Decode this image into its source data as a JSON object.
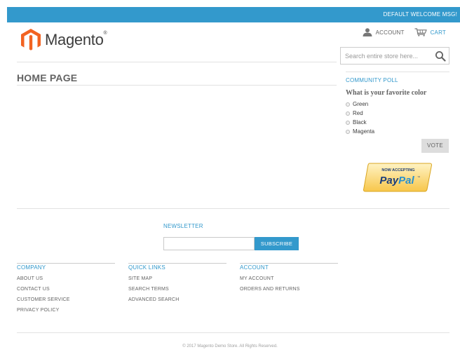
{
  "topbar": {
    "welcome": "DEFAULT WELCOME MSG!"
  },
  "header": {
    "logo_text": "Magento",
    "logo_mark": "®",
    "account_label": "ACCOUNT",
    "cart_label": "CART",
    "search_placeholder": "Search entire store here..."
  },
  "main": {
    "page_title": "HOME PAGE"
  },
  "poll": {
    "title": "COMMUNITY POLL",
    "question": "What is your favorite color",
    "options": [
      "Green",
      "Red",
      "Black",
      "Magenta"
    ],
    "vote_label": "VOTE"
  },
  "paypal": {
    "now_accepting": "NOW ACCEPTING",
    "brand": "PayPal",
    "tm": "™"
  },
  "newsletter": {
    "title": "NEWSLETTER",
    "subscribe_label": "SUBSCRIBE"
  },
  "footer": {
    "columns": [
      {
        "heading": "COMPANY",
        "links": [
          "ABOUT US",
          "CONTACT US",
          "CUSTOMER SERVICE",
          "PRIVACY POLICY"
        ]
      },
      {
        "heading": "QUICK LINKS",
        "links": [
          "SITE MAP",
          "SEARCH TERMS",
          "ADVANCED SEARCH"
        ]
      },
      {
        "heading": "ACCOUNT",
        "links": [
          "MY ACCOUNT",
          "ORDERS AND RETURNS"
        ]
      }
    ],
    "copyright": "© 2017 Magento Demo Store. All Rights Reserved."
  },
  "colors": {
    "accent": "#3399cc",
    "text": "#636363",
    "logo_orange": "#f26322"
  },
  "icons": {
    "account": "user-icon",
    "cart": "cart-icon",
    "search": "search-icon",
    "logo": "magento-logo-icon"
  }
}
